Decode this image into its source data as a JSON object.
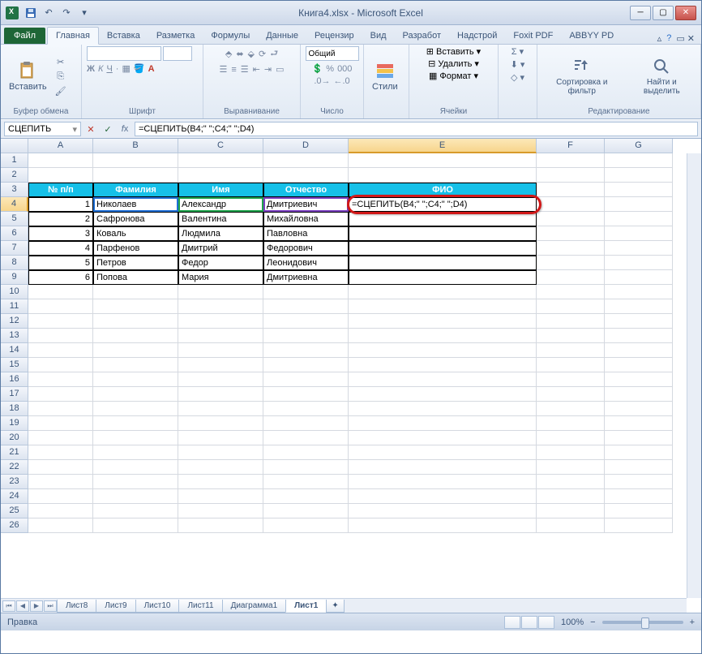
{
  "window": {
    "title": "Книга4.xlsx  -  Microsoft Excel"
  },
  "tabs": {
    "file": "Файл",
    "list": [
      "Главная",
      "Вставка",
      "Разметка",
      "Формулы",
      "Данные",
      "Рецензир",
      "Вид",
      "Разработ",
      "Надстрой",
      "Foxit PDF",
      "ABBYY PD"
    ],
    "active": 0
  },
  "ribbon": {
    "paste": "Вставить",
    "clipboard": "Буфер обмена",
    "font_group": "Шрифт",
    "align_group": "Выравнивание",
    "number_group": "Число",
    "number_format": "Общий",
    "styles": "Стили",
    "cells_group": "Ячейки",
    "insert": "Вставить",
    "delete": "Удалить",
    "format": "Формат",
    "editing_group": "Редактирование",
    "sort": "Сортировка и фильтр",
    "find": "Найти и выделить"
  },
  "formula_bar": {
    "name_box": "СЦЕПИТЬ",
    "formula": "=СЦЕПИТЬ(B4;\" \";C4;\" \";D4)"
  },
  "columns": [
    "A",
    "B",
    "C",
    "D",
    "E",
    "F",
    "G"
  ],
  "headers": {
    "a": "№ п/п",
    "b": "Фамилия",
    "c": "Имя",
    "d": "Отчество",
    "e": "ФИО"
  },
  "rows": [
    {
      "n": "1",
      "b": "Николаев",
      "c": "Александр",
      "d": "Дмитриевич",
      "e": "=СЦЕПИТЬ(B4;\" \";C4;\" \";D4)"
    },
    {
      "n": "2",
      "b": "Сафронова",
      "c": "Валентина",
      "d": "Михайловна",
      "e": ""
    },
    {
      "n": "3",
      "b": "Коваль",
      "c": "Людмила",
      "d": "Павловна",
      "e": ""
    },
    {
      "n": "4",
      "b": "Парфенов",
      "c": "Дмитрий",
      "d": "Федорович",
      "e": ""
    },
    {
      "n": "5",
      "b": "Петров",
      "c": "Федор",
      "d": "Леонидович",
      "e": ""
    },
    {
      "n": "6",
      "b": "Попова",
      "c": "Мария",
      "d": "Дмитриевна",
      "e": ""
    }
  ],
  "sheet_tabs": [
    "Лист8",
    "Лист9",
    "Лист10",
    "Лист11",
    "Диаграмма1",
    "Лист1"
  ],
  "active_sheet": 5,
  "status": {
    "left": "Правка",
    "zoom": "100%"
  }
}
